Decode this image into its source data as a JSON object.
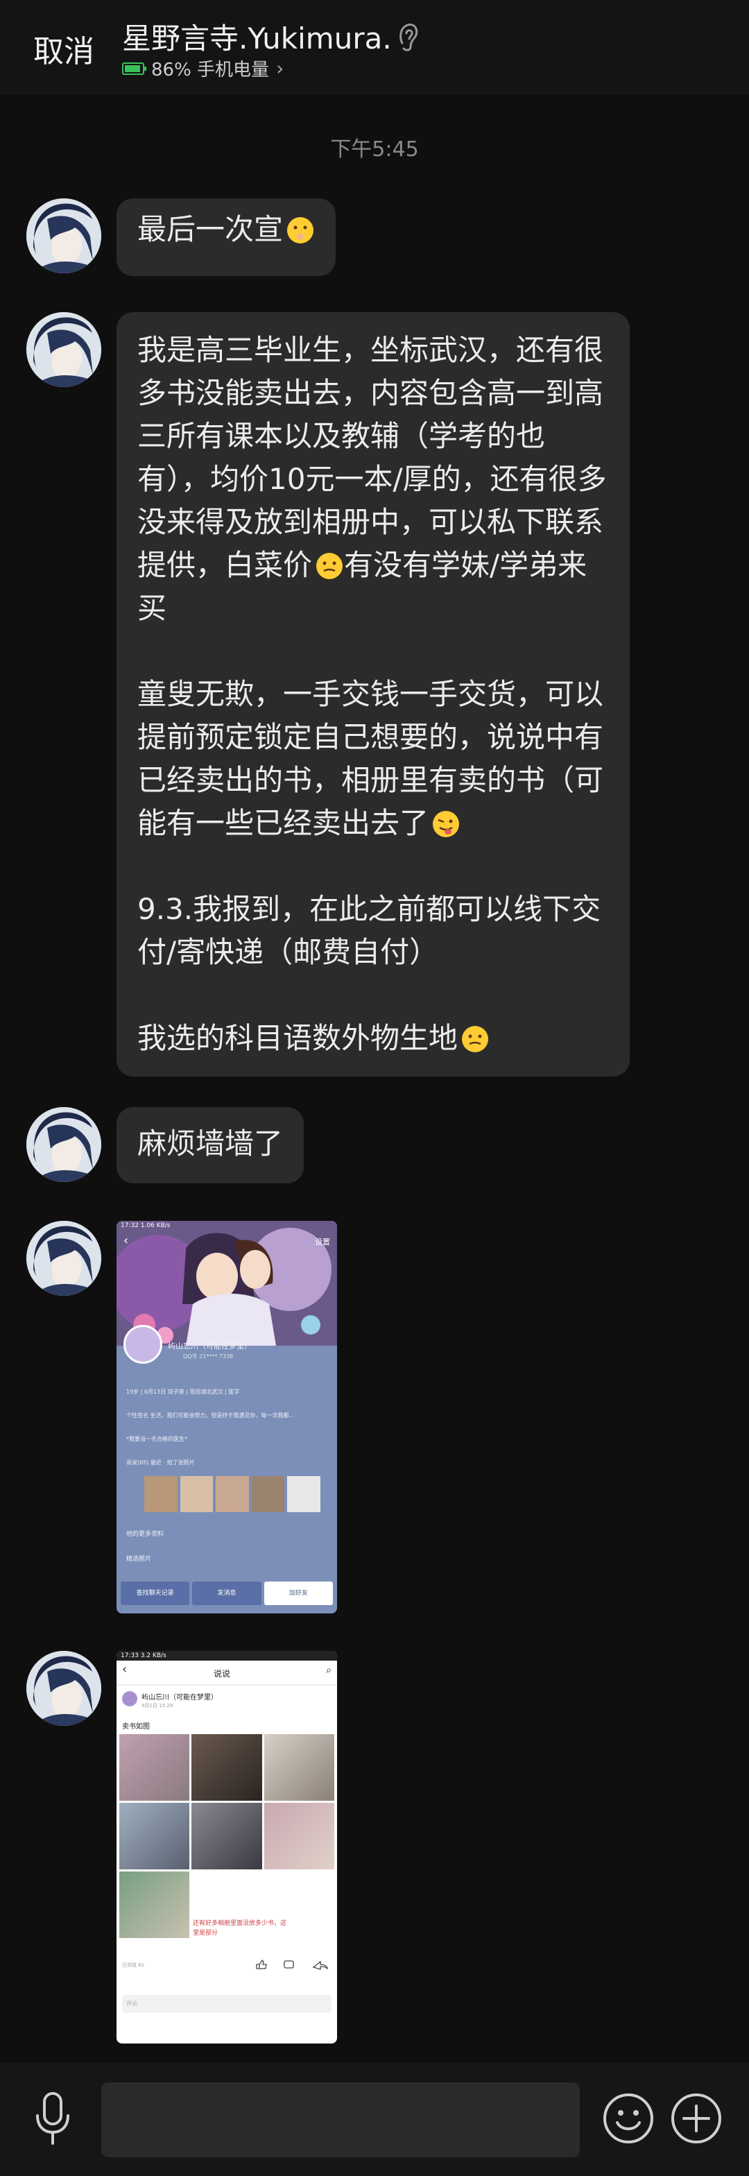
{
  "header": {
    "cancel_label": "取消",
    "title": "星野言寺.Yukimura.",
    "status_text": "86% 手机电量",
    "chevron": "›"
  },
  "chat": {
    "time": "下午5:45",
    "messages": [
      {
        "text": "最后一次宣"
      },
      {
        "paragraphs": [
          "我是高三毕业生，坐标武汉，还有很多书没能卖出去，内容包含高一到高三所有课本以及教辅（学考的也有），均价10元一本/厚的，还有很多没来得及放到相册中，可以私下联系提供，白菜价",
          "有没有学妹/学弟来买",
          "童叟无欺，一手交钱一手交货，可以提前预定锁定自己想要的，说说中有已经卖出的书，相册里有卖的书（可能有一些已经卖出去了",
          "9.3.我报到，在此之前都可以线下交付/寄快递（邮费自付）",
          "我选的科目语数外物生地"
        ]
      },
      {
        "text": "麻烦墙墙了"
      }
    ],
    "screenshot1": {
      "status": "17:32 1.06 KB/s",
      "back": "‹",
      "settings": "设置",
      "name": "屿山忘川（可能在梦里）",
      "id": "QQ号 21**** 7338",
      "info_rows": [
        "19岁 | 6月13日 双子座 | 现居湖北武汉 | 医学",
        "个性签名 生活，我们可能会努力，但是终于我遇见你，每一次我都...",
        "*我要当一名合格的医生*",
        "说说(65) 最近 · 拍了张照片"
      ],
      "footer_row": "他的更多资料",
      "footer_row2": "精选照片",
      "buttons": [
        "查找聊天记录",
        "发消息",
        "加好友"
      ]
    },
    "screenshot2": {
      "status": "17:33 3.2 KB/s",
      "back": "‹",
      "tab": "说说",
      "search": "⌕",
      "poster": "屿山忘川（可能在梦里）",
      "poster_time": "9月1日 15:29",
      "caption": "卖书如图",
      "handwritten": "还有好多相册里面没放多少书，这里是部分",
      "meta": "已浏览 61",
      "comment_placeholder": "评论"
    }
  },
  "input": {
    "placeholder": ""
  },
  "colors": {
    "background": "#0f0f0f",
    "bubble": "#2b2b2b",
    "battery": "#39c25a",
    "profile_card": "#7c8fb8"
  }
}
